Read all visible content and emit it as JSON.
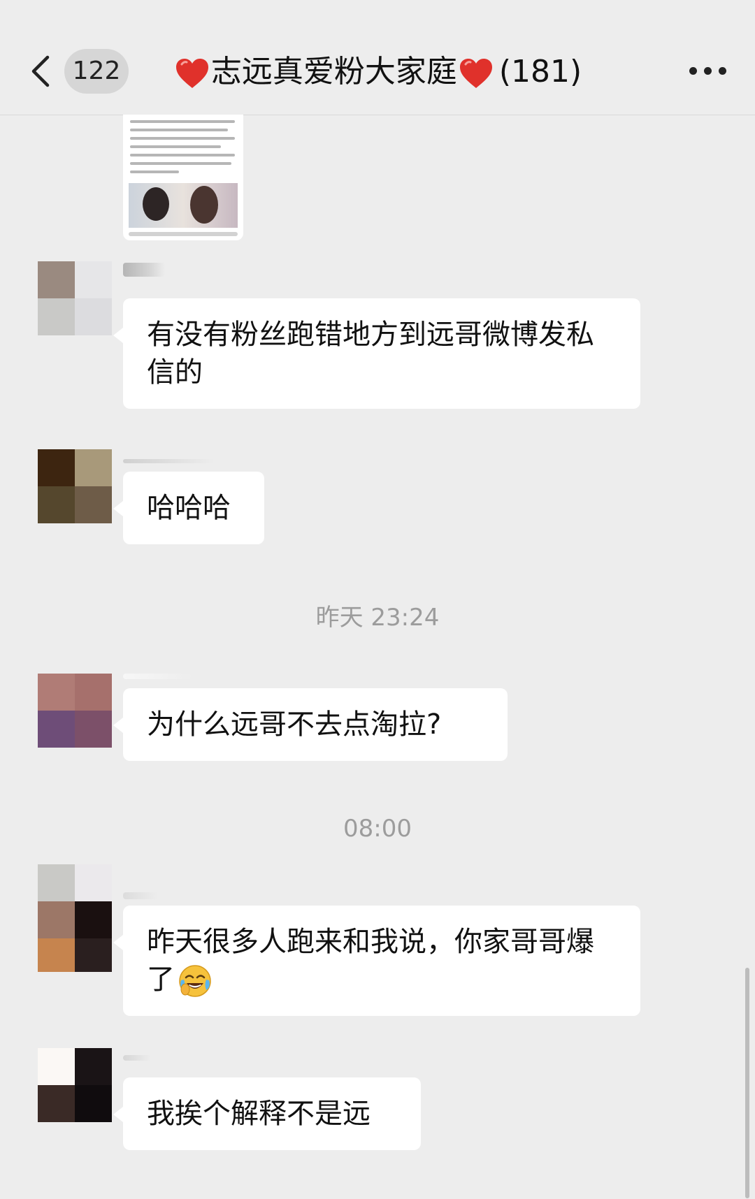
{
  "header": {
    "back_label": "返回",
    "unread_count": "122",
    "title": "志远真爱粉大家庭",
    "member_count": "(181)",
    "more_label": "更多"
  },
  "messages": [
    {
      "type": "text",
      "text": "有没有粉丝跑错地方到远哥微博发私信的"
    },
    {
      "type": "text",
      "text": "哈哈哈"
    },
    {
      "type": "time",
      "text": "昨天 23:24"
    },
    {
      "type": "text",
      "text": "为什么远哥不去点淘拉?"
    },
    {
      "type": "time",
      "text": "08:00"
    },
    {
      "type": "text",
      "text": "昨天很多人跑来和我说，你家哥哥爆了",
      "emoji": "crying-laughing-emoji"
    },
    {
      "type": "text",
      "text": "我挨个解释不是远"
    }
  ],
  "colors": {
    "background": "#ededed",
    "bubble": "#ffffff",
    "heart": "#e0312b"
  }
}
